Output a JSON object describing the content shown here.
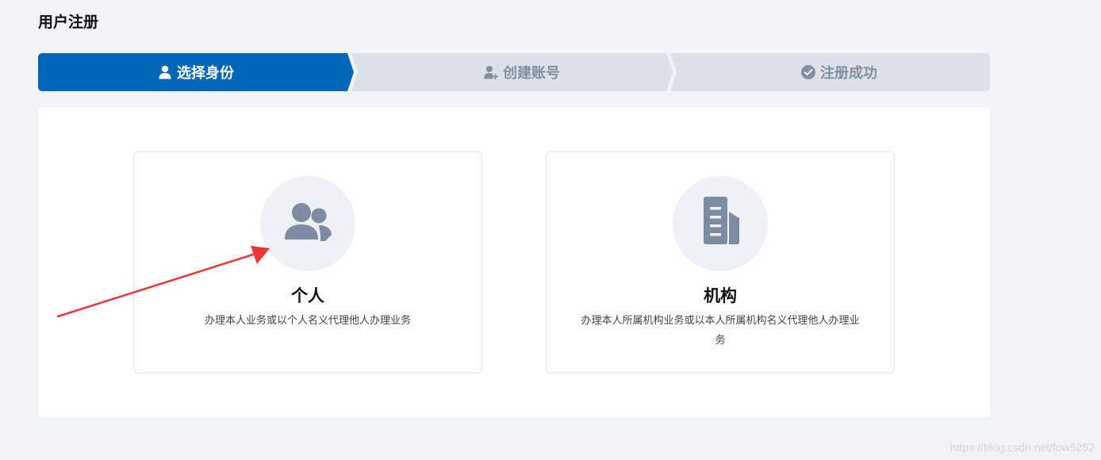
{
  "page": {
    "title": "用户注册"
  },
  "stepper": {
    "steps": [
      {
        "label": "选择身份",
        "icon": "user-icon",
        "state": "active"
      },
      {
        "label": "创建账号",
        "icon": "user-add-icon",
        "state": "pending"
      },
      {
        "label": "注册成功",
        "icon": "check-circle-icon",
        "state": "pending"
      }
    ],
    "active_color": "#0066b8",
    "inactive_color": "#dde2e8"
  },
  "options": [
    {
      "title": "个人",
      "description": "办理本人业务或以个人名义代理他人办理业务",
      "icon": "users-icon"
    },
    {
      "title": "机构",
      "description": "办理本人所属机构业务或以本人所属机构名义代理他人办理业务",
      "icon": "building-document-icon"
    }
  ],
  "annotation": {
    "color": "#e8383a"
  },
  "watermark": "https://blog.csdn.net/fow5252"
}
